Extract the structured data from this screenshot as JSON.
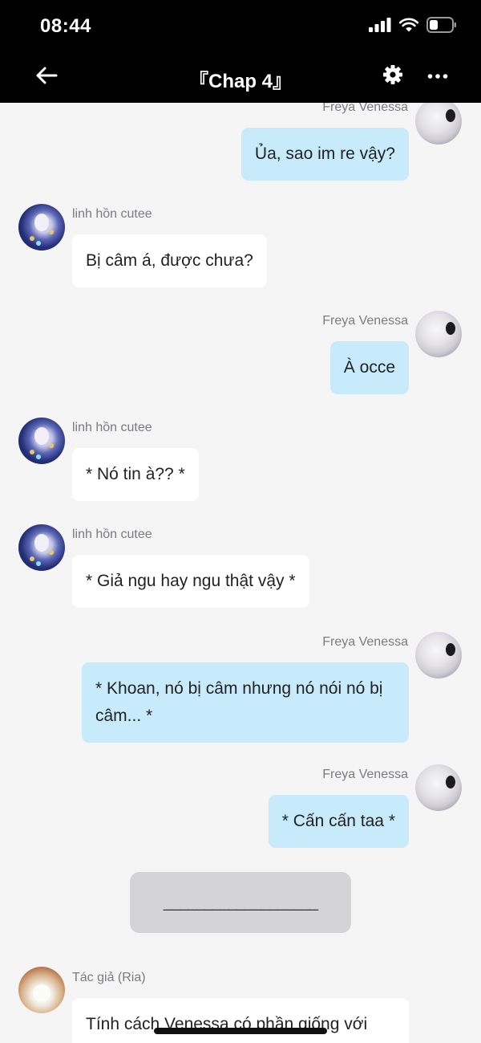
{
  "status_bar": {
    "time": "08:44",
    "icons": [
      "cellular-signal-icon",
      "wifi-icon",
      "battery-icon"
    ]
  },
  "header": {
    "title": "『Chap 4』",
    "back_icon": "arrow-left-icon",
    "settings_icon": "gear-icon",
    "more_icon": "more-horizontal-icon"
  },
  "colors": {
    "bar_background": "#000000",
    "chat_background": "#f5f5f6",
    "incoming_bubble": "#ffffff",
    "outgoing_bubble": "#c8ebfb",
    "divider_card": "#d4d4d6",
    "name_text": "#7b7b80"
  },
  "messages": [
    {
      "sender": "Freya Venessa",
      "side": "right",
      "text": "Ủa, sao im re vậy?"
    },
    {
      "sender": "linh hồn cutee",
      "side": "left",
      "text": "Bị câm á, được chưa?"
    },
    {
      "sender": "Freya Venessa",
      "side": "right",
      "text": "À occe"
    },
    {
      "sender": "linh hồn cutee",
      "side": "left",
      "text": "* Nó tin à?? *"
    },
    {
      "sender": "linh hồn cutee",
      "side": "left",
      "text": "* Giả ngu hay ngu thật vậy *"
    },
    {
      "sender": "Freya Venessa",
      "side": "right",
      "text": "* Khoan, nó bị câm nhưng nó nói nó bị câm... *"
    },
    {
      "sender": "Freya Venessa",
      "side": "right",
      "text": "* Cấn cấn taa *"
    },
    {
      "sender": "Tác giả (Ria)",
      "side": "left",
      "text": "Tính cách Venessa có phần giống với"
    }
  ],
  "divider": {
    "text": "___________________"
  }
}
